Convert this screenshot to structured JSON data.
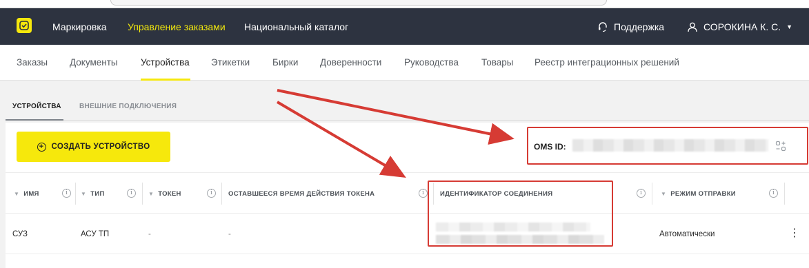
{
  "topbar": {
    "nav": [
      {
        "label": "Маркировка",
        "active": false
      },
      {
        "label": "Управление заказами",
        "active": true
      },
      {
        "label": "Национальный каталог",
        "active": false
      }
    ],
    "support_label": "Поддержка",
    "user_label": "СОРОКИНА К. С."
  },
  "subnav": {
    "items": [
      {
        "label": "Заказы"
      },
      {
        "label": "Документы"
      },
      {
        "label": "Устройства",
        "active": true
      },
      {
        "label": "Этикетки"
      },
      {
        "label": "Бирки"
      },
      {
        "label": "Доверенности"
      },
      {
        "label": "Руководства"
      },
      {
        "label": "Товары"
      },
      {
        "label": "Реестр интеграционных решений"
      }
    ]
  },
  "page_tabs": [
    {
      "label": "УСТРОЙСТВА",
      "active": true
    },
    {
      "label": "ВНЕШНИЕ ПОДКЛЮЧЕНИЯ",
      "active": false
    }
  ],
  "create_button": {
    "label": "СОЗДАТЬ УСТРОЙСТВО"
  },
  "oms": {
    "label": "OMS ID:"
  },
  "table": {
    "columns": [
      {
        "label": "ИМЯ",
        "sortable": true
      },
      {
        "label": "ТИП",
        "sortable": true
      },
      {
        "label": "ТОКЕН",
        "sortable": true
      },
      {
        "label": "ОСТАВШЕЕСЯ ВРЕМЯ ДЕЙСТВИЯ ТОКЕНА",
        "sortable": false
      },
      {
        "label": "ИДЕНТИФИКАТОР СОЕДИНЕНИЯ",
        "sortable": false
      },
      {
        "label": "РЕЖИМ ОТПРАВКИ",
        "sortable": true
      }
    ],
    "rows": [
      {
        "name": "СУЗ",
        "type": "АСУ ТП",
        "token": "-",
        "token_time": "-",
        "send_mode": "Автоматически"
      }
    ]
  },
  "colors": {
    "topbar_bg": "#2d3340",
    "accent_yellow": "#f6e80c",
    "annotation_red": "#d63b34"
  },
  "icons": [
    "logo-icon",
    "headset-icon",
    "user-icon",
    "chevron-down-icon",
    "plus-circle-icon",
    "info-icon",
    "copy-icon",
    "kebab-menu-icon"
  ]
}
